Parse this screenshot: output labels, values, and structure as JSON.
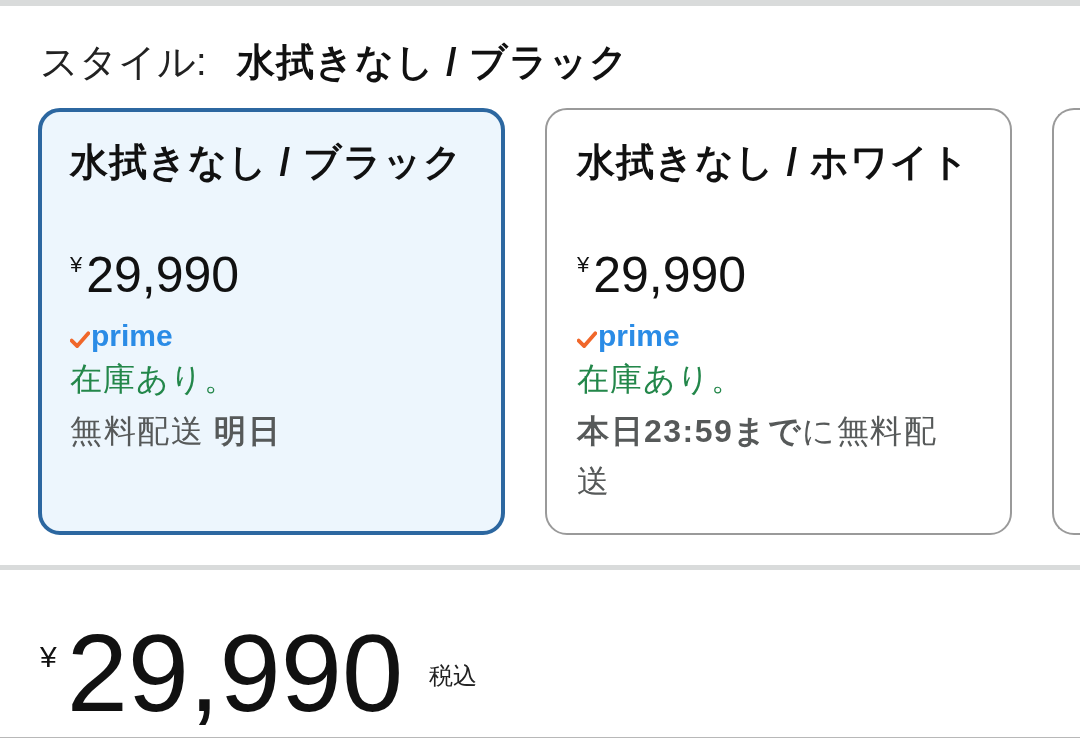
{
  "style_selector": {
    "label": "スタイル:",
    "value": "水拭きなし / ブラック"
  },
  "options": [
    {
      "title": "水拭きなし / ブラック",
      "currency": "¥",
      "price": "29,990",
      "badge": "prime",
      "stock": "在庫あり。",
      "delivery": "無料配送 **明日**",
      "selected": true
    },
    {
      "title": "水拭きなし / ホワイト",
      "currency": "¥",
      "price": "29,990",
      "badge": "prime",
      "stock": "在庫あり。",
      "delivery": "**本日23:59まで**に無料配送",
      "selected": false
    },
    {
      "selected": false
    }
  ],
  "price_summary": {
    "currency": "¥",
    "amount": "29,990",
    "tax_note": "税込"
  }
}
